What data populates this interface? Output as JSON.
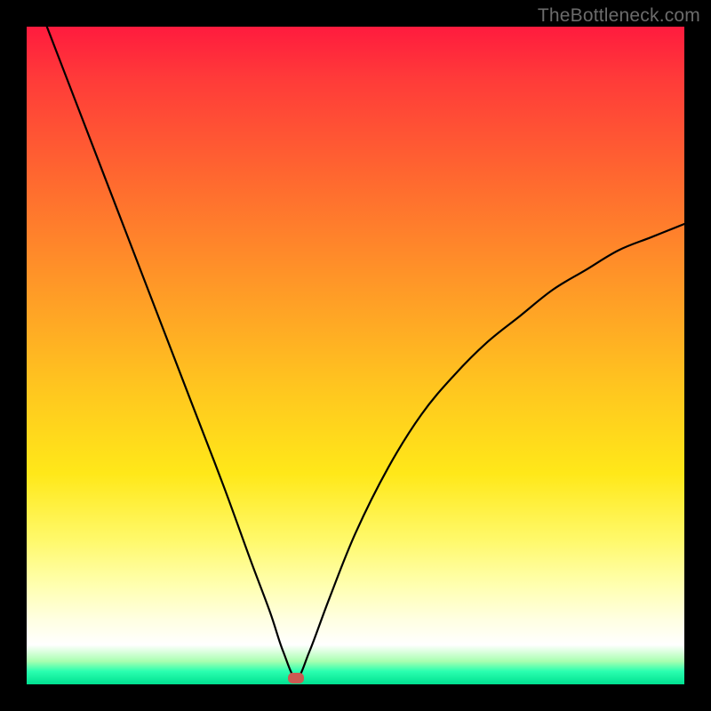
{
  "watermark": "TheBottleneck.com",
  "colors": {
    "frame": "#000000",
    "curve": "#000000",
    "marker": "#cc5a52",
    "gradient_stops": [
      "#ff1b3e",
      "#ff3b39",
      "#ff6b2f",
      "#ff9a27",
      "#ffc61f",
      "#ffe819",
      "#fff96a",
      "#ffffb0",
      "#ffffe0",
      "#ffffff",
      "#a8ffb0",
      "#2bffb0",
      "#00e090"
    ]
  },
  "chart_data": {
    "type": "line",
    "title": "",
    "xlabel": "",
    "ylabel": "",
    "xlim": [
      0,
      100
    ],
    "ylim": [
      0,
      100
    ],
    "x_minimum": 41,
    "series": [
      {
        "name": "bottleneck-curve",
        "x": [
          0,
          5,
          10,
          15,
          20,
          25,
          30,
          34,
          37,
          39,
          41,
          43,
          46,
          50,
          55,
          60,
          65,
          70,
          75,
          80,
          85,
          90,
          95,
          100
        ],
        "values": [
          108,
          95,
          82,
          69,
          56,
          43,
          30,
          19,
          11,
          5,
          1,
          5,
          13,
          23,
          33,
          41,
          47,
          52,
          56,
          60,
          63,
          66,
          68,
          70
        ]
      }
    ],
    "marker": {
      "x": 41,
      "y": 1
    }
  }
}
